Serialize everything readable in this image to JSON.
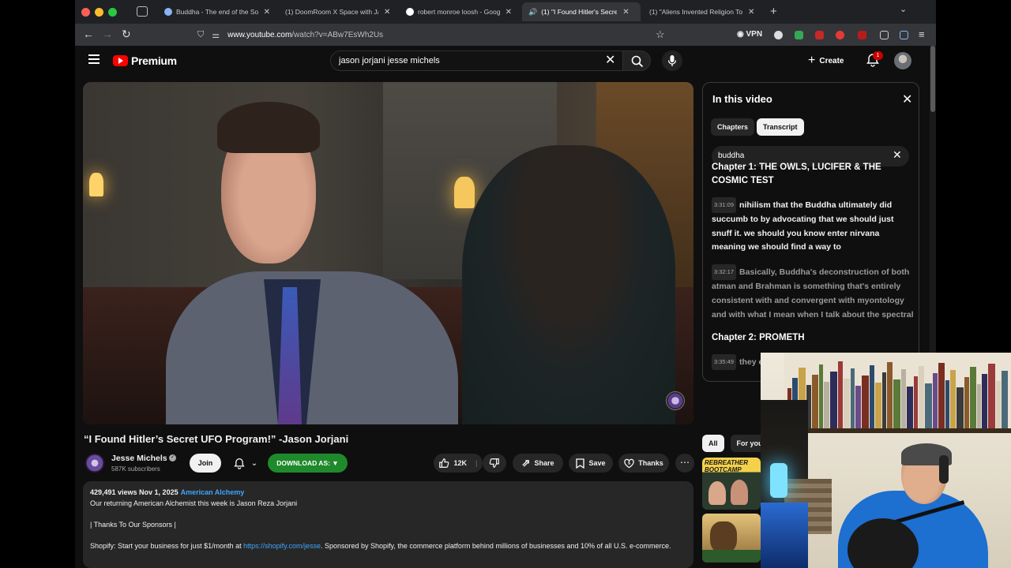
{
  "browser": {
    "tabs": [
      {
        "title": "Buddha - The end of the Soul a",
        "favicon": "circle",
        "active": false
      },
      {
        "title": "(1) DoomRoom X Space with Ja",
        "favicon": "yt",
        "active": false
      },
      {
        "title": "robert monroe loosh - Google S",
        "favicon": "g",
        "active": false
      },
      {
        "title": "(1) \"I Found Hitler's Secret",
        "favicon": "yt",
        "active": true
      },
      {
        "title": "(1) \"Aliens Invented Religion To",
        "favicon": "yt",
        "active": false
      }
    ],
    "url_host": "www.youtube.com",
    "url_path": "/watch?v=ABw7EsWh2Us",
    "vpn_label": "VPN"
  },
  "youtube": {
    "logo_word": "Premium",
    "search_query": "jason jorjani jesse michels",
    "create_label": "Create",
    "notification_count": "1"
  },
  "video": {
    "title": "“I Found Hitler’s Secret UFO Program!” -Jason Jorjani"
  },
  "channel": {
    "name": "Jesse Michels",
    "verified_mark": "✓",
    "subscribers": "587K subscribers",
    "join_label": "Join",
    "download_label": "DOWNLOAD AS: ▼"
  },
  "actions": {
    "like_count": "12K",
    "share_label": "Share",
    "save_label": "Save",
    "thanks_label": "Thanks",
    "more": "⋯"
  },
  "description": {
    "meta": "429,491 views  Nov 1, 2025",
    "hashtag": "American Alchemy",
    "line1": "Our returning American Alchemist this week is Jason Reza Jorjani",
    "line2": "| Thanks To Our Sponsors |",
    "line3_pre": "Shopify: Start your business for just $1/month at ",
    "line3_link": "https://shopify.com/jesse",
    "line3_post": ". Sponsored by Shopify, the commerce platform behind millions of businesses and 10% of all U.S. e-commerce."
  },
  "panel": {
    "title": "In this video",
    "tab_chapters": "Chapters",
    "tab_transcript": "Transcript",
    "transcript_query": "buddha",
    "chapter1": "Chapter 1: THE OWLS, LUCIFER & THE COSMIC TEST",
    "segments": [
      {
        "time": "3:31:09",
        "text": "nihilism that the Buddha ultimately did succumb to by advocating that we should just snuff it. we should you know enter nirvana meaning we should find a way to"
      },
      {
        "time": "3:32:17",
        "text": "Basically, Buddha's deconstruction of both atman and Brahman is something that's entirely consistent with and convergent with myontology and with what I mean when I talk about the spectral"
      }
    ],
    "chapter2": "Chapter 2: PROMETH",
    "segment3": {
      "time": "3:35:49",
      "text": "they emanations"
    }
  },
  "filters": {
    "all": "All",
    "for_you": "For you"
  },
  "thumbnail1_text": "REBREATHER BOOTCAMP",
  "colors": {
    "youtube_red": "#ff0000",
    "link_blue": "#3ea6ff",
    "download_green": "#1f8a2b"
  }
}
